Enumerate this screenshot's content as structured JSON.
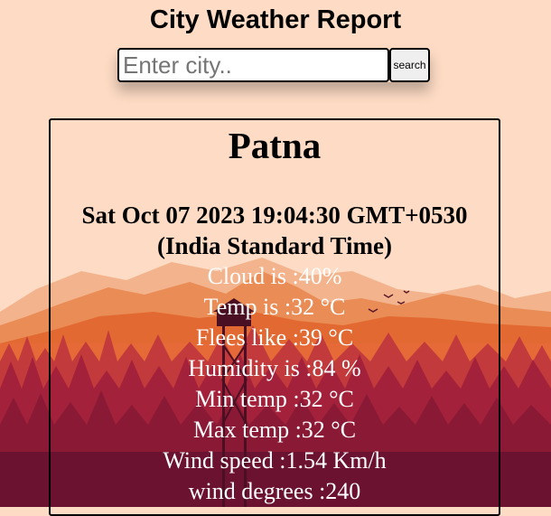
{
  "header": {
    "title": "City Weather Report"
  },
  "search": {
    "placeholder": "Enter city..",
    "value": "",
    "button_label": "search"
  },
  "weather": {
    "city": "Patna",
    "datetime": "Sat Oct 07 2023 19:04:30 GMT+0530 (India Standard Time)",
    "stats": [
      {
        "text": "Cloud is :40%"
      },
      {
        "text": "Temp is :32 °C"
      },
      {
        "text": "Flees like :39 °C"
      },
      {
        "text": "Humidity is :84 %"
      },
      {
        "text": "Min temp :32 °C"
      },
      {
        "text": "Max temp :32 °C"
      },
      {
        "text": "Wind speed :1.54 Km/h"
      },
      {
        "text": "wind degrees :240"
      }
    ]
  },
  "colors": {
    "background": "#fddbc4",
    "mountain_far": "#f0a27a",
    "mountain_near": "#e5743f",
    "forest": "#a3213a",
    "forest_dark": "#6b1230"
  }
}
